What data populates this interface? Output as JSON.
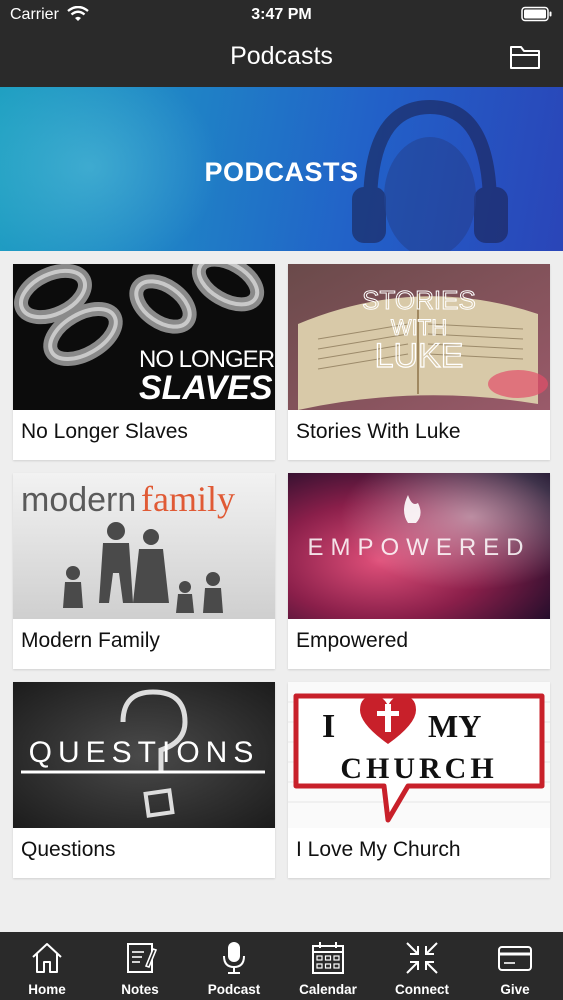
{
  "status_bar": {
    "carrier": "Carrier",
    "time": "3:47 PM"
  },
  "nav": {
    "title": "Podcasts",
    "right_icon": "folder-icon"
  },
  "banner": {
    "title": "PODCASTS"
  },
  "podcasts": [
    {
      "label": "No Longer Slaves",
      "art_text": [
        "NO LONGER",
        "SLAVES"
      ]
    },
    {
      "label": "Stories With Luke",
      "art_text": [
        "STORIES",
        "WITH",
        "LUKE"
      ]
    },
    {
      "label": "Modern Family",
      "art_text": [
        "modern",
        "family"
      ]
    },
    {
      "label": "Empowered",
      "art_text": [
        "EMPOWERED"
      ]
    },
    {
      "label": "Questions",
      "art_text": [
        "QUESTIONS"
      ]
    },
    {
      "label": "I Love My Church",
      "art_text": [
        "I",
        "MY",
        "CHURCH"
      ]
    }
  ],
  "tabs": [
    {
      "label": "Home",
      "icon": "home-icon"
    },
    {
      "label": "Notes",
      "icon": "notes-icon"
    },
    {
      "label": "Podcast",
      "icon": "microphone-icon"
    },
    {
      "label": "Calendar",
      "icon": "calendar-icon"
    },
    {
      "label": "Connect",
      "icon": "connect-icon"
    },
    {
      "label": "Give",
      "icon": "credit-card-icon"
    }
  ],
  "colors": {
    "bar": "#2a2a2a",
    "background": "#eeeeee",
    "banner_start": "#1fa0c2",
    "banner_end": "#2a45b8",
    "heart_red": "#c8202a"
  }
}
